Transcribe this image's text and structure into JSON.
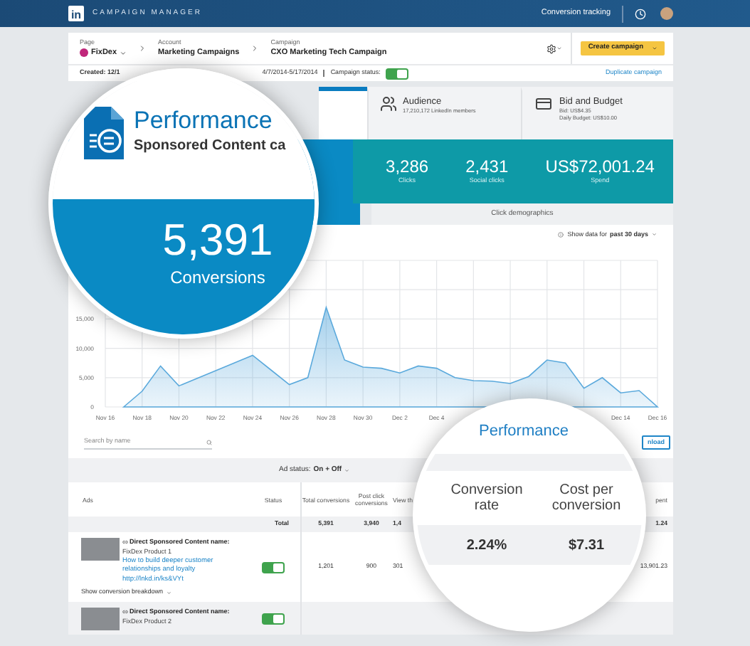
{
  "top_bar": {
    "logo": "in",
    "brand": "CAMPAIGN MANAGER",
    "link": "Conversion tracking"
  },
  "breadcrumb": [
    {
      "label": "Page",
      "value": "FixDex"
    },
    {
      "label": "Account",
      "value": "Marketing Campaigns"
    },
    {
      "label": "Campaign",
      "value": "CXO Marketing Tech Campaign"
    }
  ],
  "create_button": "Create campaign",
  "info_row": {
    "created": "Created: 12/1",
    "dates": "4/7/2014-5/17/2014",
    "status_label": "Campaign status:",
    "status_on": true,
    "link": "Duplicate campaign"
  },
  "tabs": [
    {
      "kind": "performance",
      "selected": true
    },
    {
      "kind": "audience",
      "title": "Audience",
      "lines": [
        "17,210,172 LinkedIn members"
      ],
      "selected": false
    },
    {
      "kind": "budget",
      "title": "Bid and Budget",
      "lines": [
        "Bid: US$4.35",
        "Daily Budget: US$10.00"
      ],
      "selected": false
    }
  ],
  "stats": [
    {
      "value": "3,286",
      "label": "Clicks"
    },
    {
      "value": "2,431",
      "label": "Social clicks"
    },
    {
      "value": "US$72,001.24",
      "label": "Spend"
    }
  ],
  "demographics_tab": "Click demographics",
  "range": {
    "prefix": "Show data for",
    "value": "past 30 days"
  },
  "chart_data": {
    "type": "area",
    "categories": [
      "Nov 16",
      null,
      "Nov 18",
      null,
      "Nov 20",
      null,
      "Nov 22",
      null,
      "Nov 24",
      null,
      "Nov 26",
      null,
      "Nov 28",
      null,
      "Nov 30",
      null,
      "Dec 2",
      null,
      "Dec 4",
      null,
      null,
      null,
      null,
      null,
      null,
      null,
      null,
      null,
      "Dec 14",
      null,
      "Dec 16"
    ],
    "ylim": [
      0,
      25000
    ],
    "grid": true,
    "yticks": [
      0,
      {
        "value": 5000,
        "label": "5,000"
      },
      {
        "value": 10000,
        "label": "10,000"
      },
      {
        "value": 15000,
        "label": "15,000"
      }
    ],
    "series": [
      {
        "color": "#5aa9dc",
        "values": [
          null,
          0,
          2700,
          7000,
          3600,
          null,
          null,
          7500,
          8800,
          6300,
          3800,
          5000,
          17000,
          8000,
          6800,
          6600,
          5800,
          7000,
          6600,
          5000,
          4500,
          4400,
          4000,
          5200,
          8000,
          7500,
          3200,
          5000,
          2400,
          2800,
          0
        ]
      }
    ]
  },
  "search": {
    "placeholder": "Search by name"
  },
  "download": "nload",
  "ad_status": {
    "label": "Ad status:",
    "value": "On + Off"
  },
  "table": {
    "columns": [
      "Ads",
      "Status",
      "Total conversions",
      "Post click conversions",
      "View th",
      "pent"
    ],
    "total": {
      "cells": [
        "",
        "Total",
        "5,391",
        "3,940",
        "1,4",
        "1.24"
      ]
    },
    "rows": [
      {
        "type_label": "Direct Sponsored Content name:",
        "name": "FixDex Product 1",
        "link": "How to build deeper customer relationships and loyalty http://lnkd.in/ks&VYt",
        "on": true,
        "cells": [
          "",
          "",
          "1,201",
          "900",
          "301",
          "13,901.23"
        ],
        "breakdown": "Show conversion breakdown"
      },
      {
        "type_label": "Direct Sponsored Content name:",
        "name": "FixDex Product 2",
        "on": true,
        "cells": []
      }
    ]
  },
  "magnifier_main": {
    "title": "Performance",
    "subtitle": "Sponsored Content ca",
    "value": "5,391",
    "label": "Conversions"
  },
  "magnifier_table": {
    "title": "Performance",
    "columns": [
      "Conversion rate",
      "Cost per conversion"
    ],
    "values": [
      "2.24%",
      "$7.31"
    ]
  }
}
